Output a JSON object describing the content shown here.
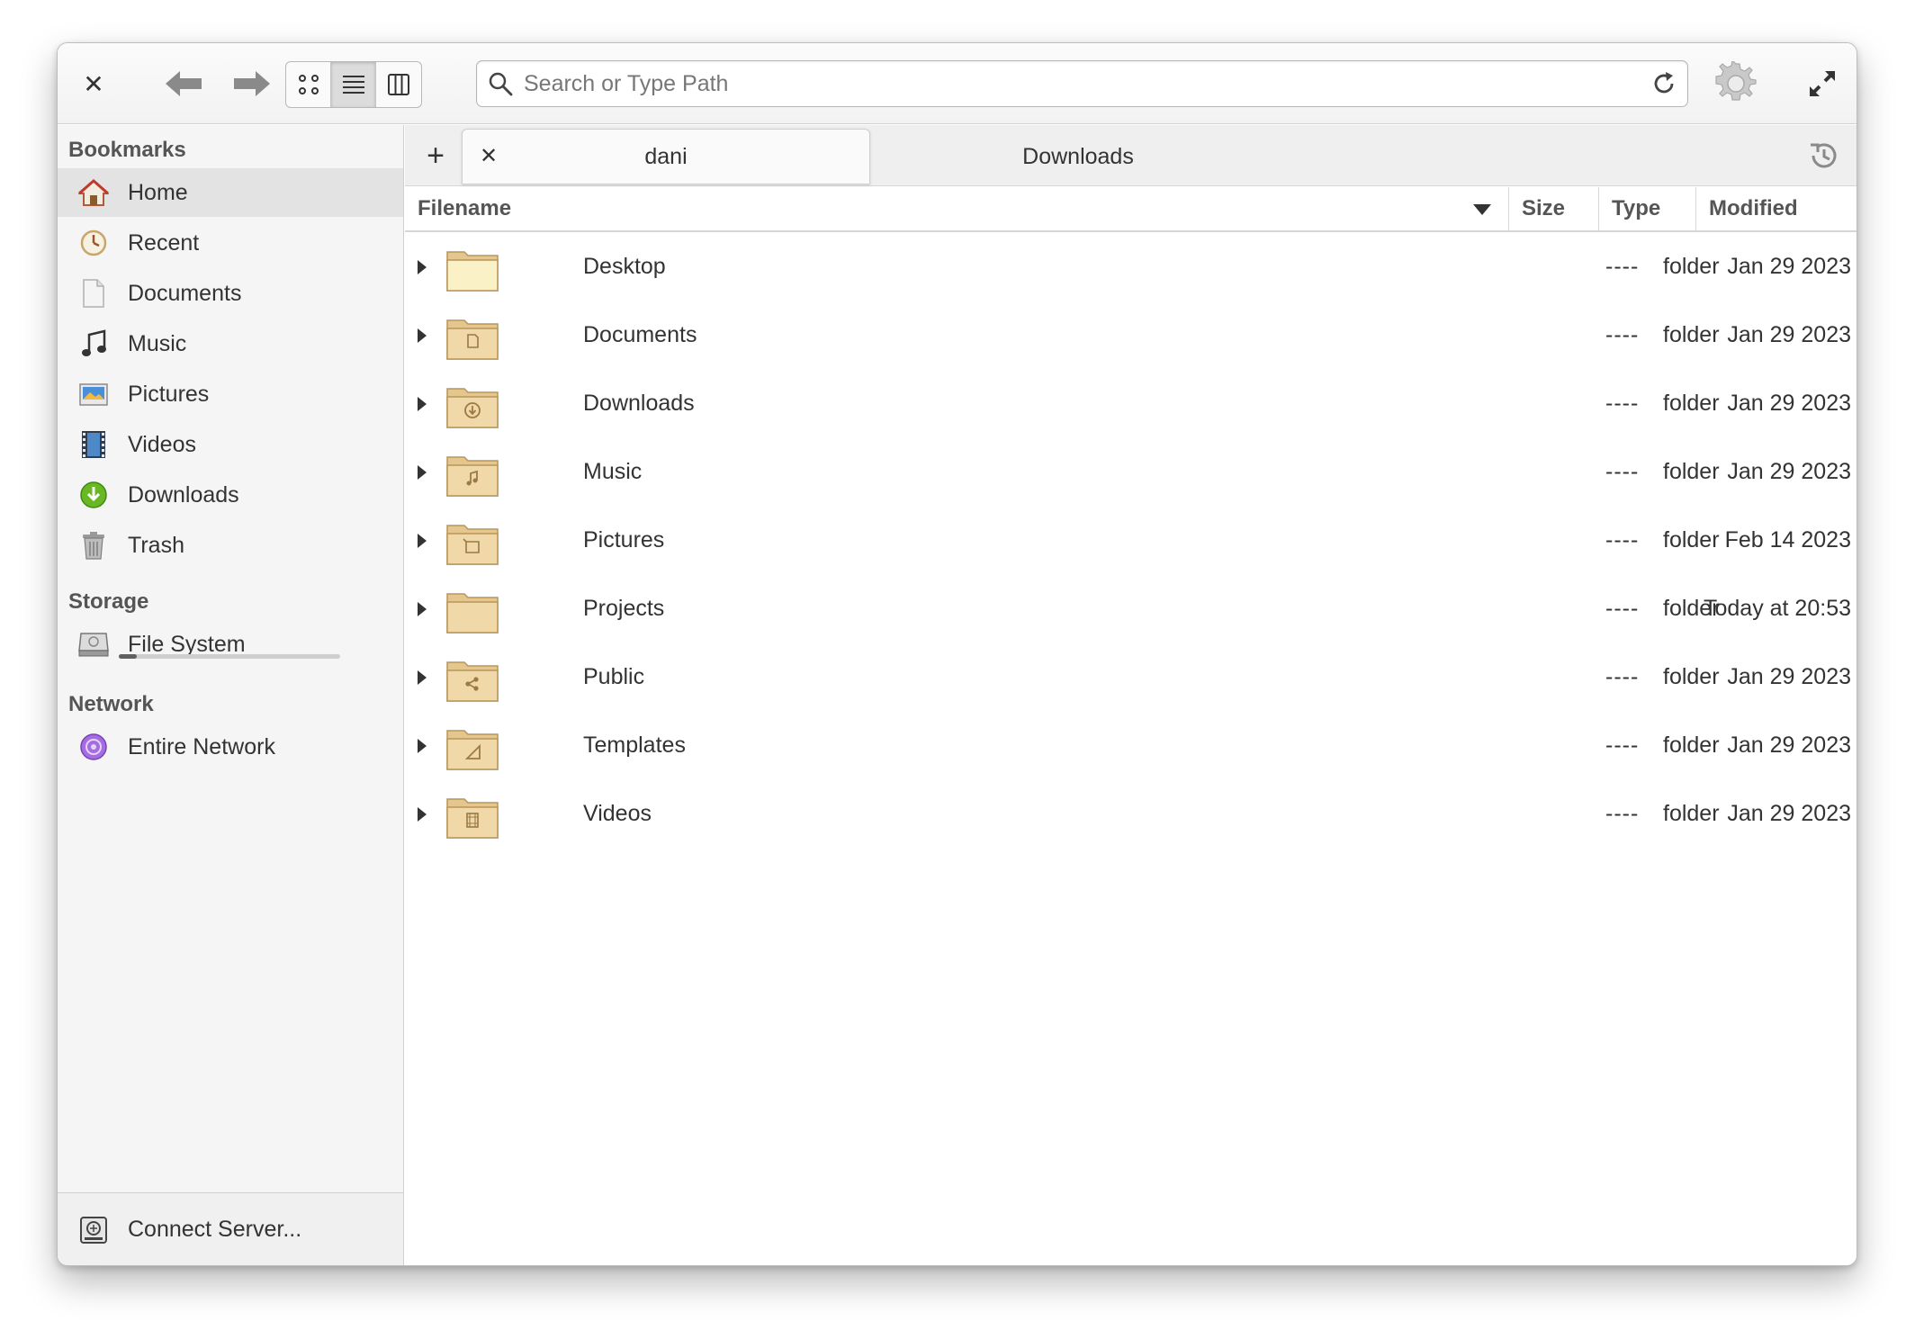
{
  "toolbar": {
    "search_placeholder": "Search or Type Path"
  },
  "sidebar": {
    "bookmarks_heading": "Bookmarks",
    "bookmarks": [
      {
        "label": "Home",
        "icon": "home-icon"
      },
      {
        "label": "Recent",
        "icon": "recent-icon"
      },
      {
        "label": "Documents",
        "icon": "document-icon"
      },
      {
        "label": "Music",
        "icon": "music-icon"
      },
      {
        "label": "Pictures",
        "icon": "pictures-icon"
      },
      {
        "label": "Videos",
        "icon": "videos-icon"
      },
      {
        "label": "Downloads",
        "icon": "downloads-icon"
      },
      {
        "label": "Trash",
        "icon": "trash-icon"
      }
    ],
    "storage_heading": "Storage",
    "storage": [
      {
        "label": "File System",
        "icon": "drive-icon",
        "usage_fraction": 0.08
      }
    ],
    "network_heading": "Network",
    "network": [
      {
        "label": "Entire Network",
        "icon": "network-icon"
      }
    ],
    "connect_server": "Connect Server..."
  },
  "tabs": [
    {
      "label": "dani",
      "active": true
    },
    {
      "label": "Downloads",
      "active": false
    }
  ],
  "columns": {
    "filename": "Filename",
    "size": "Size",
    "type": "Type",
    "modified": "Modified"
  },
  "files": [
    {
      "name": "Desktop",
      "size": "----",
      "type": "folder",
      "modified": "Jan 29 2023",
      "emblem": "none"
    },
    {
      "name": "Documents",
      "size": "----",
      "type": "folder",
      "modified": "Jan 29 2023",
      "emblem": "document"
    },
    {
      "name": "Downloads",
      "size": "----",
      "type": "folder",
      "modified": "Jan 29 2023",
      "emblem": "download"
    },
    {
      "name": "Music",
      "size": "----",
      "type": "folder",
      "modified": "Jan 29 2023",
      "emblem": "music"
    },
    {
      "name": "Pictures",
      "size": "----",
      "type": "folder",
      "modified": "Feb 14 2023",
      "emblem": "picture"
    },
    {
      "name": "Projects",
      "size": "----",
      "type": "folder",
      "modified": "Today at 20:53",
      "emblem": "none"
    },
    {
      "name": "Public",
      "size": "----",
      "type": "folder",
      "modified": "Jan 29 2023",
      "emblem": "share"
    },
    {
      "name": "Templates",
      "size": "----",
      "type": "folder",
      "modified": "Jan 29 2023",
      "emblem": "template"
    },
    {
      "name": "Videos",
      "size": "----",
      "type": "folder",
      "modified": "Jan 29 2023",
      "emblem": "video"
    }
  ],
  "colors": {
    "folder": "#f0d8a8",
    "folder_desktop": "#fbf1c6",
    "accent_green": "#68b723"
  }
}
